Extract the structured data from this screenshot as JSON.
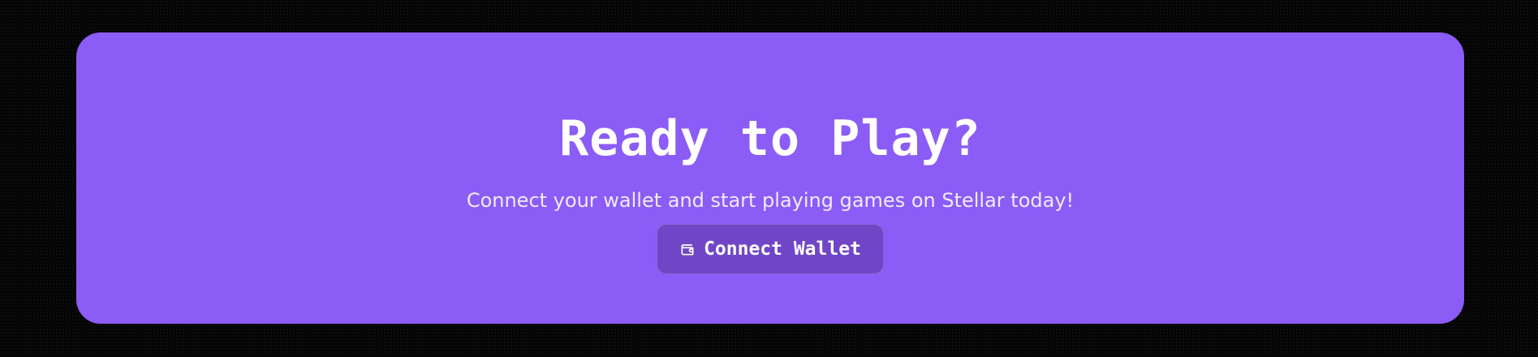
{
  "cta": {
    "title": "Ready to Play?",
    "subtitle": "Connect your wallet and start playing games on Stellar today!",
    "button": {
      "label": "Connect Wallet",
      "icon": "wallet-icon"
    }
  },
  "colors": {
    "background": "#050505",
    "card": "#8b5cf6",
    "button": "#7046c7",
    "text": "#ffffff"
  }
}
